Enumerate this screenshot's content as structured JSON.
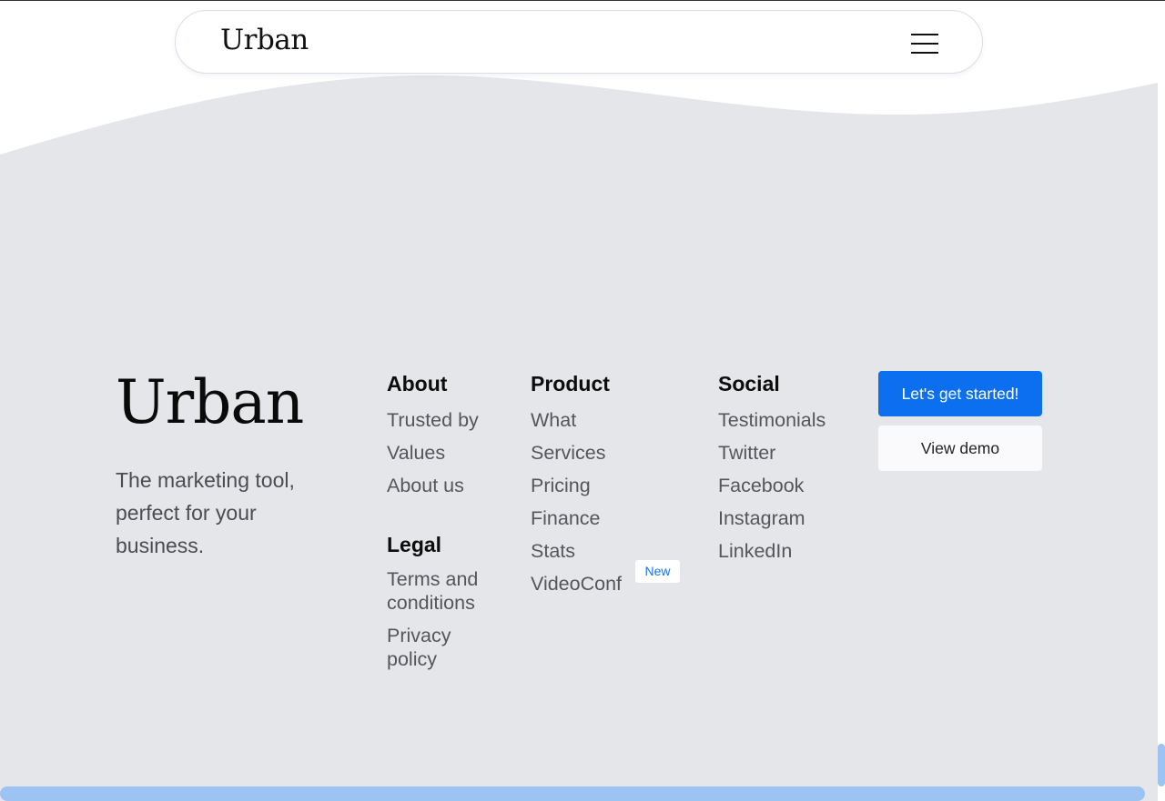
{
  "colors": {
    "footer_bg": "#e5e6ea",
    "primary": "#0b6ff0",
    "link": "#55555c",
    "badge_text": "#1a73e8"
  },
  "navbar": {
    "logo": "Urban",
    "menu_icon": "hamburger-menu-icon"
  },
  "footer": {
    "logo": "Urban",
    "tagline": "The marketing tool, perfect for your business.",
    "about": {
      "title": "About",
      "links": [
        "Trusted by",
        "Values",
        "About us"
      ]
    },
    "legal": {
      "title": "Legal",
      "links": [
        "Terms and conditions",
        "Privacy policy"
      ]
    },
    "product": {
      "title": "Product",
      "links": [
        "What",
        "Services",
        "Pricing",
        "Finance",
        "Stats",
        "VideoConf"
      ],
      "badge": "New"
    },
    "social": {
      "title": "Social",
      "links": [
        "Testimonials",
        "Twitter",
        "Facebook",
        "Instagram",
        "LinkedIn"
      ]
    },
    "cta": {
      "primary": "Let's get started!",
      "secondary": "View demo"
    }
  }
}
